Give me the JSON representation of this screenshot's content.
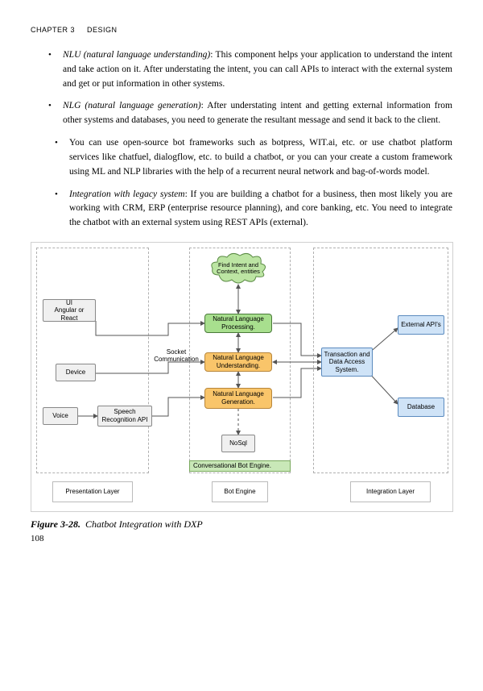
{
  "header": {
    "chapter": "CHAPTER 3",
    "title": "DESIGN"
  },
  "bullets": {
    "nlu_term": "NLU (natural language understanding)",
    "nlu_text": ": This component helps your application to understand the intent and take action on it. After understating the intent, you can call APIs to interact with the external system and get or put information in other systems.",
    "nlg_term": "NLG (natural language generation)",
    "nlg_text": ": After understating intent and getting external information from other systems and databases, you need to generate the resultant message and send it back to the client.",
    "frameworks": "You can use open-source bot frameworks such as botpress, WIT.ai, etc. or use chatbot platform services like chatfuel, dialogflow, etc. to build a chatbot, or you can your create a custom framework using ML and NLP libraries with the help of a recurrent neural network and bag-of-words model.",
    "integration_term": "Integration with legacy system",
    "integration_text": ": If you are building a chatbot for a business, then most likely you are working with CRM, ERP (enterprise resource planning), and core banking, etc. You need to integrate the chatbot with an external system using REST APIs (external)."
  },
  "diagram": {
    "cloud": "Find Intent and Context, entities",
    "ui": "UI\nAngular or  React",
    "device": "Device",
    "voice": "Voice",
    "speech": "Speech Recognition API",
    "socket": "Socket Communication",
    "nlp": "Natural Language Processing.",
    "nlu": "Natural Language Understanding.",
    "nlg": "Natural Language Generation.",
    "nosql": "NoSql",
    "engine": "Conversational   Bot   Engine.",
    "transaction": "Transaction and Data Access System.",
    "external": "External API's",
    "database": "Database",
    "layer_presentation": "Presentation Layer",
    "layer_bot": "Bot Engine",
    "layer_integration": "Integration Layer"
  },
  "caption": {
    "fignum": "Figure 3-28.",
    "text": "Chatbot Integration with DXP"
  },
  "page": "108"
}
